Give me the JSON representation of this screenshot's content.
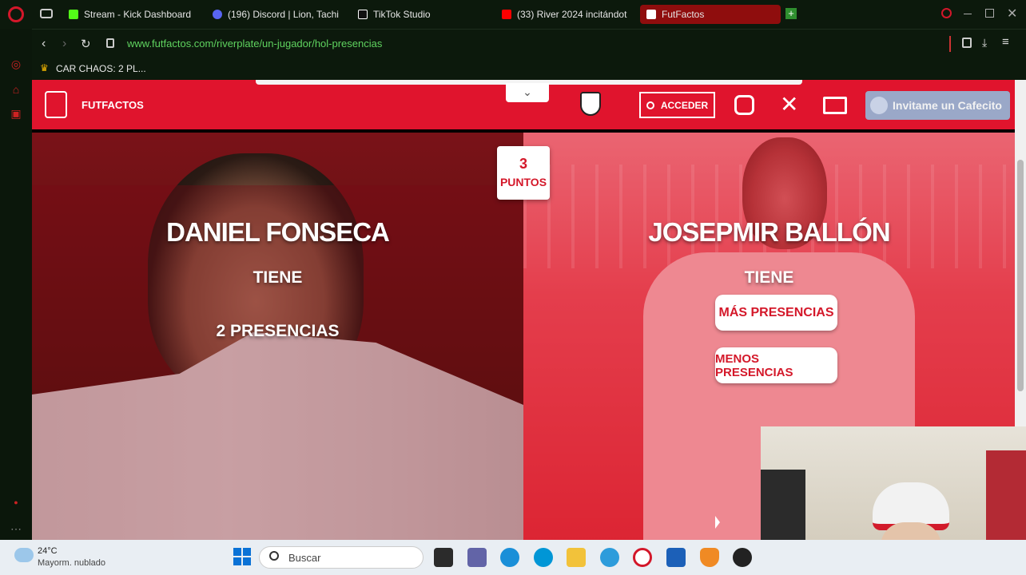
{
  "tabs": [
    {
      "label": "Stream - Kick Dashboard",
      "color": "#53fc18"
    },
    {
      "label": "(196) Discord | Lion, Tachi",
      "color": "#5865f2"
    },
    {
      "label": "TikTok Studio",
      "color": "#ffffff"
    },
    {
      "label": "(33) River 2024 incitándot",
      "color": "#ff0000"
    },
    {
      "label": "FutFactos",
      "color": "#ffffff"
    }
  ],
  "address": {
    "url": "www.futfactos.com/riverplate/un-jugador/hol-presencias"
  },
  "bookmarks": {
    "item": "CAR CHAOS: 2 PL..."
  },
  "nav": {
    "brand": "FUTFACTOS",
    "login": "ACCEDER",
    "coffee": "Invitame un Cafecito",
    "accent": "#e0142d"
  },
  "score": {
    "value": "3",
    "label": "PUNTOS"
  },
  "left_player": {
    "name": "DANIEL FONSECA",
    "verb": "TIENE",
    "stat": "2 PRESENCIAS"
  },
  "right_player": {
    "name": "JOSEPMIR BALLÓN",
    "verb": "TIENE",
    "more": "MÁS PRESENCIAS",
    "less": "MENOS PRESENCIAS"
  },
  "taskbar": {
    "temp": "24°C",
    "weather": "Mayorm. nublado",
    "search": "Buscar"
  }
}
